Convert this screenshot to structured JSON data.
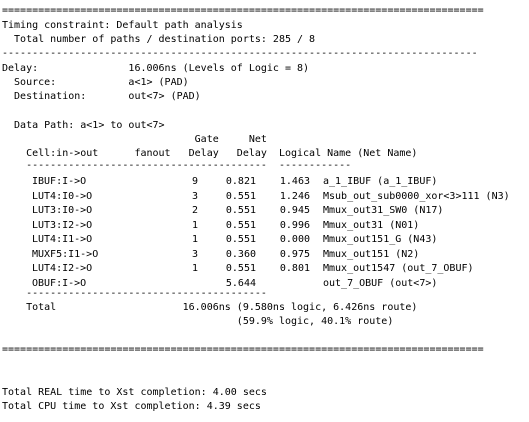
{
  "lines": {
    "sep_top": "================================================================================",
    "timing_constraint": "Timing constraint: Default path analysis",
    "total_paths": "  Total number of paths / destination ports: 285 / 8",
    "sep_dash": "-------------------------------------------------------------------------------",
    "delay": "Delay:               16.006ns (Levels of Logic = 8)",
    "source": "  Source:            a<1> (PAD)",
    "destination": "  Destination:       out<7> (PAD)",
    "data_path": "  Data Path: a<1> to out<7>",
    "hdr1": "                                Gate     Net",
    "hdr2": "    Cell:in->out      fanout   Delay   Delay  Logical Name (Net Name)",
    "hdr_sep": "    ----------------------------------------  ------------",
    "total_sep": "    ----------------------------------------",
    "total": "    Total                     16.006ns (9.580ns logic, 6.426ns route)",
    "total_pct": "                                       (59.9% logic, 40.1% route)",
    "sep_bottom": "================================================================================",
    "real_time": "Total REAL time to Xst completion: 4.00 secs",
    "cpu_time": "Total CPU time to Xst completion: 4.39 secs"
  },
  "rows": [
    {
      "cell": "IBUF:I->O",
      "fanout": "9",
      "gate": "0.821",
      "net": "1.463",
      "name": "a_1_IBUF (a_1_IBUF)"
    },
    {
      "cell": "LUT4:I0->O",
      "fanout": "3",
      "gate": "0.551",
      "net": "1.246",
      "name": "Msub_out_sub0000_xor<3>111 (N3)"
    },
    {
      "cell": "LUT3:I0->O",
      "fanout": "2",
      "gate": "0.551",
      "net": "0.945",
      "name": "Mmux_out31_SW0 (N17)"
    },
    {
      "cell": "LUT3:I2->O",
      "fanout": "1",
      "gate": "0.551",
      "net": "0.996",
      "name": "Mmux_out31 (N01)"
    },
    {
      "cell": "LUT4:I1->O",
      "fanout": "1",
      "gate": "0.551",
      "net": "0.000",
      "name": "Mmux_out151_G (N43)"
    },
    {
      "cell": "MUXF5:I1->O",
      "fanout": "3",
      "gate": "0.360",
      "net": "0.975",
      "name": "Mmux_out151 (N2)"
    },
    {
      "cell": "LUT4:I2->O",
      "fanout": "1",
      "gate": "0.551",
      "net": "0.801",
      "name": "Mmux_out1547 (out_7_OBUF)"
    },
    {
      "cell": "OBUF:I->O",
      "fanout": "",
      "gate": "5.644",
      "net": "",
      "name": "out_7_OBUF (out<7>)"
    }
  ]
}
